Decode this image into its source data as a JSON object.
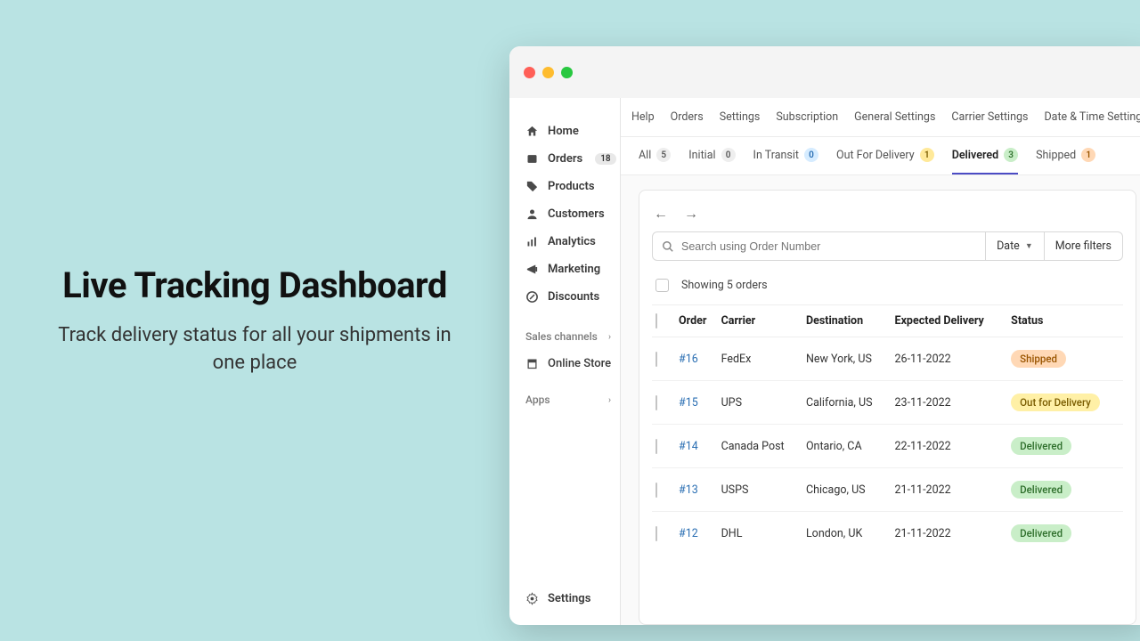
{
  "hero": {
    "title": "Live Tracking Dashboard",
    "subtitle": "Track delivery status for all your shipments in one place"
  },
  "sidebar": {
    "items": [
      {
        "label": "Home"
      },
      {
        "label": "Orders",
        "badge": "18"
      },
      {
        "label": "Products"
      },
      {
        "label": "Customers"
      },
      {
        "label": "Analytics"
      },
      {
        "label": "Marketing"
      },
      {
        "label": "Discounts"
      }
    ],
    "sales_channels_label": "Sales channels",
    "online_store_label": "Online Store",
    "apps_label": "Apps",
    "settings_label": "Settings"
  },
  "topnav": [
    "Help",
    "Orders",
    "Settings",
    "Subscription",
    "General Settings",
    "Carrier Settings",
    "Date & Time Settings"
  ],
  "tabs": [
    {
      "label": "All",
      "count": "5",
      "pill": "pill-grey"
    },
    {
      "label": "Initial",
      "count": "0",
      "pill": "pill-grey"
    },
    {
      "label": "In Transit",
      "count": "0",
      "pill": "pill-blue"
    },
    {
      "label": "Out For Delivery",
      "count": "1",
      "pill": "pill-yellow"
    },
    {
      "label": "Delivered",
      "count": "3",
      "pill": "pill-green",
      "active": true
    },
    {
      "label": "Shipped",
      "count": "1",
      "pill": "pill-orange"
    }
  ],
  "search": {
    "placeholder": "Search using Order Number",
    "date_label": "Date",
    "more_filters_label": "More filters"
  },
  "count_text": "Showing 5 orders",
  "columns": [
    "Order",
    "Carrier",
    "Destination",
    "Expected Delivery",
    "Status"
  ],
  "rows": [
    {
      "order": "#16",
      "carrier": "FedEx",
      "dest": "New York, US",
      "date": "26-11-2022",
      "status": "Shipped",
      "badge": "b-shipped"
    },
    {
      "order": "#15",
      "carrier": "UPS",
      "dest": "California, US",
      "date": "23-11-2022",
      "status": "Out for Delivery",
      "badge": "b-outfordel"
    },
    {
      "order": "#14",
      "carrier": "Canada Post",
      "dest": "Ontario, CA",
      "date": "22-11-2022",
      "status": "Delivered",
      "badge": "b-delivered"
    },
    {
      "order": "#13",
      "carrier": "USPS",
      "dest": "Chicago, US",
      "date": "21-11-2022",
      "status": "Delivered",
      "badge": "b-delivered"
    },
    {
      "order": "#12",
      "carrier": "DHL",
      "dest": "London, UK",
      "date": "21-11-2022",
      "status": "Delivered",
      "badge": "b-delivered"
    }
  ]
}
